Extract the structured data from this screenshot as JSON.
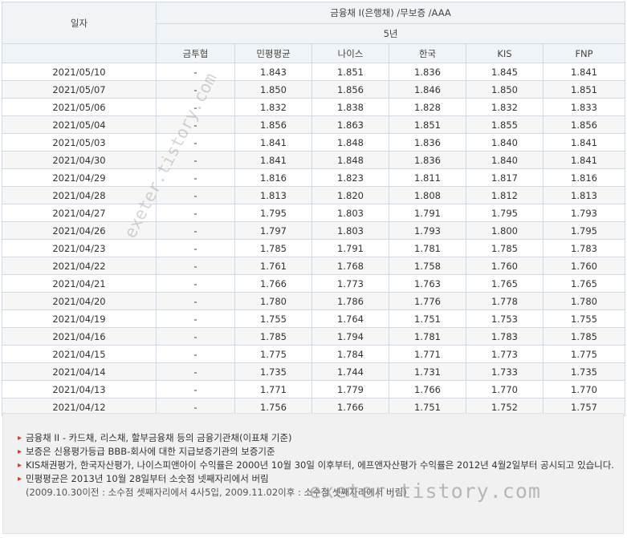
{
  "header": {
    "date_col": "일자",
    "group": "금융채 I(은행채) /무보증 /AAA",
    "tenor": "5년",
    "cols": [
      "금투협",
      "민평평균",
      "나이스",
      "한국",
      "KIS",
      "FNP"
    ]
  },
  "rows": [
    {
      "date": "2021/05/10",
      "kofia": "-",
      "avg": "1.843",
      "nice": "1.851",
      "korea": "1.836",
      "kis": "1.845",
      "fnp": "1.841"
    },
    {
      "date": "2021/05/07",
      "kofia": "-",
      "avg": "1.850",
      "nice": "1.856",
      "korea": "1.846",
      "kis": "1.850",
      "fnp": "1.851"
    },
    {
      "date": "2021/05/06",
      "kofia": "-",
      "avg": "1.832",
      "nice": "1.838",
      "korea": "1.828",
      "kis": "1.832",
      "fnp": "1.833"
    },
    {
      "date": "2021/05/04",
      "kofia": "-",
      "avg": "1.856",
      "nice": "1.863",
      "korea": "1.851",
      "kis": "1.855",
      "fnp": "1.856"
    },
    {
      "date": "2021/05/03",
      "kofia": "-",
      "avg": "1.841",
      "nice": "1.848",
      "korea": "1.836",
      "kis": "1.840",
      "fnp": "1.841"
    },
    {
      "date": "2021/04/30",
      "kofia": "-",
      "avg": "1.841",
      "nice": "1.848",
      "korea": "1.836",
      "kis": "1.840",
      "fnp": "1.841"
    },
    {
      "date": "2021/04/29",
      "kofia": "-",
      "avg": "1.816",
      "nice": "1.823",
      "korea": "1.811",
      "kis": "1.817",
      "fnp": "1.816"
    },
    {
      "date": "2021/04/28",
      "kofia": "-",
      "avg": "1.813",
      "nice": "1.820",
      "korea": "1.808",
      "kis": "1.812",
      "fnp": "1.813"
    },
    {
      "date": "2021/04/27",
      "kofia": "-",
      "avg": "1.795",
      "nice": "1.803",
      "korea": "1.791",
      "kis": "1.795",
      "fnp": "1.793"
    },
    {
      "date": "2021/04/26",
      "kofia": "-",
      "avg": "1.797",
      "nice": "1.803",
      "korea": "1.793",
      "kis": "1.800",
      "fnp": "1.795"
    },
    {
      "date": "2021/04/23",
      "kofia": "-",
      "avg": "1.785",
      "nice": "1.791",
      "korea": "1.781",
      "kis": "1.785",
      "fnp": "1.783"
    },
    {
      "date": "2021/04/22",
      "kofia": "-",
      "avg": "1.761",
      "nice": "1.768",
      "korea": "1.758",
      "kis": "1.760",
      "fnp": "1.760"
    },
    {
      "date": "2021/04/21",
      "kofia": "-",
      "avg": "1.766",
      "nice": "1.773",
      "korea": "1.763",
      "kis": "1.765",
      "fnp": "1.765"
    },
    {
      "date": "2021/04/20",
      "kofia": "-",
      "avg": "1.780",
      "nice": "1.786",
      "korea": "1.776",
      "kis": "1.778",
      "fnp": "1.780"
    },
    {
      "date": "2021/04/19",
      "kofia": "-",
      "avg": "1.755",
      "nice": "1.764",
      "korea": "1.751",
      "kis": "1.753",
      "fnp": "1.755"
    },
    {
      "date": "2021/04/16",
      "kofia": "-",
      "avg": "1.785",
      "nice": "1.794",
      "korea": "1.781",
      "kis": "1.783",
      "fnp": "1.785"
    },
    {
      "date": "2021/04/15",
      "kofia": "-",
      "avg": "1.775",
      "nice": "1.784",
      "korea": "1.771",
      "kis": "1.773",
      "fnp": "1.775"
    },
    {
      "date": "2021/04/14",
      "kofia": "-",
      "avg": "1.735",
      "nice": "1.744",
      "korea": "1.731",
      "kis": "1.733",
      "fnp": "1.735"
    },
    {
      "date": "2021/04/13",
      "kofia": "-",
      "avg": "1.771",
      "nice": "1.779",
      "korea": "1.766",
      "kis": "1.770",
      "fnp": "1.770"
    },
    {
      "date": "2021/04/12",
      "kofia": "-",
      "avg": "1.756",
      "nice": "1.766",
      "korea": "1.751",
      "kis": "1.752",
      "fnp": "1.757"
    }
  ],
  "notes": [
    {
      "text": "금융채 II - 카드채, 리스채, 할부금융채 등의 금융기관채(이표채 기준)"
    },
    {
      "text": "보증은 신용평가등급 BBB-회사에 대한 지급보증기관의 보증기준"
    },
    {
      "text": "KIS채권평가, 한국자산평가, 나이스피앤아이 수익률은 2000년 10월 30일 이후부터, 에프앤자산평가 수익률은 2012년 4월2일부터 공시되고 있습니다."
    },
    {
      "text": "민평평균은 2013년 10월 28일부터 소숫점 넷째자리에서 버림",
      "sub": "(2009.10.30이전 : 소수점 셋째자리에서 4사5입, 2009.11.02이후 : 소수점 셋째자리에서 버림)"
    }
  ],
  "watermark": "exeter.tistory.com",
  "colors": {
    "bullet": "#d23c2c",
    "header_bg": "#f1f4f7",
    "border": "#d3d9e0"
  }
}
